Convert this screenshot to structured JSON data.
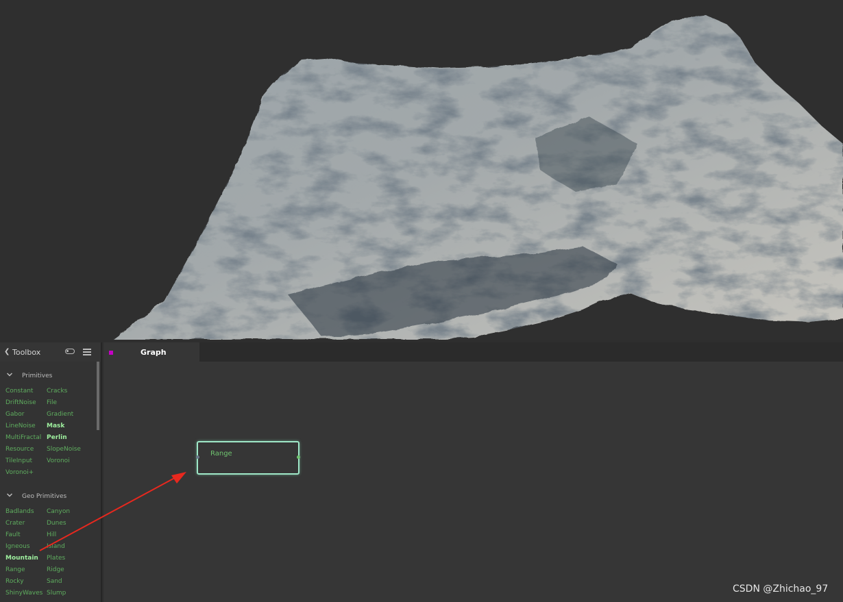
{
  "toolbox": {
    "title": "Toolbox",
    "sections": [
      {
        "label": "Primitives",
        "items": [
          {
            "label": "Constant"
          },
          {
            "label": "Cracks"
          },
          {
            "label": "DriftNoise"
          },
          {
            "label": "File"
          },
          {
            "label": "Gabor"
          },
          {
            "label": "Gradient"
          },
          {
            "label": "LineNoise"
          },
          {
            "label": "Mask",
            "highlighted": true
          },
          {
            "label": "MultiFractal"
          },
          {
            "label": "Perlin",
            "highlighted": true
          },
          {
            "label": "Resource"
          },
          {
            "label": "SlopeNoise"
          },
          {
            "label": "TileInput"
          },
          {
            "label": "Voronoi"
          },
          {
            "label": "Voronoi+"
          }
        ]
      },
      {
        "label": "Geo Primitives",
        "items": [
          {
            "label": "Badlands"
          },
          {
            "label": "Canyon"
          },
          {
            "label": "Crater"
          },
          {
            "label": "Dunes"
          },
          {
            "label": "Fault"
          },
          {
            "label": "Hill"
          },
          {
            "label": "Igneous"
          },
          {
            "label": "Island"
          },
          {
            "label": "Mountain",
            "highlighted": true
          },
          {
            "label": "Plates"
          },
          {
            "label": "Range"
          },
          {
            "label": "Ridge"
          },
          {
            "label": "Rocky"
          },
          {
            "label": "Sand"
          },
          {
            "label": "ShinyWaves"
          },
          {
            "label": "Slump"
          }
        ]
      }
    ]
  },
  "graph": {
    "tab_label": "Graph",
    "node": {
      "label": "Range"
    }
  },
  "watermark": "CSDN @Zhichao_97",
  "colors": {
    "item_green": "#5fae5f",
    "item_highlight": "#9ff09f",
    "node_border": "#9fe8c8",
    "tab_marker": "#c400c4",
    "arrow": "#e8281e"
  }
}
